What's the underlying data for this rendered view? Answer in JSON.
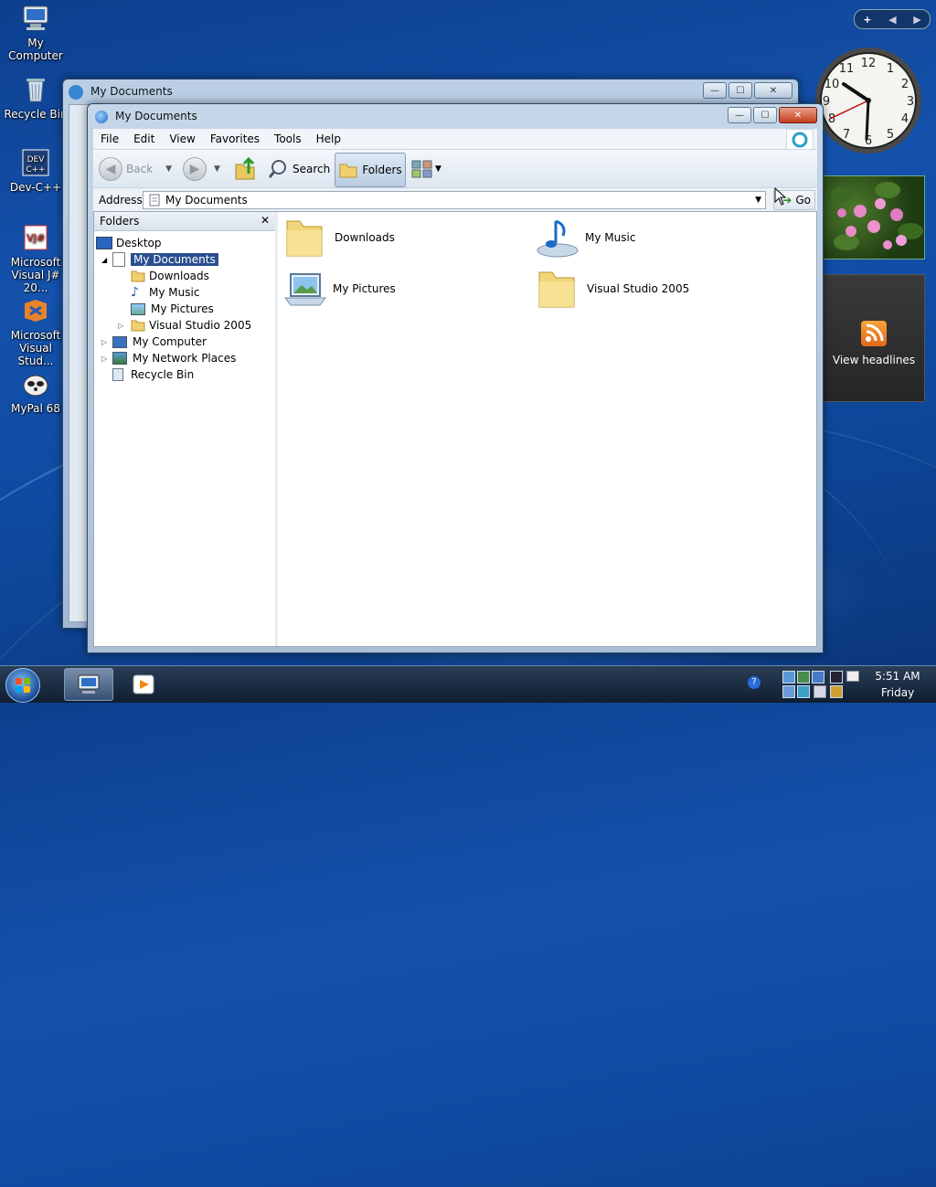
{
  "desktop": {
    "icons": [
      {
        "label": "My Computer"
      },
      {
        "label": "Recycle Bin"
      },
      {
        "label": "Dev-C++"
      },
      {
        "label": "Microsoft Visual J# 20..."
      },
      {
        "label": "Microsoft Visual Stud..."
      },
      {
        "label": "MyPal 68"
      }
    ]
  },
  "back_window": {
    "title": "My Documents"
  },
  "window": {
    "title": "My Documents",
    "menu": [
      "File",
      "Edit",
      "View",
      "Favorites",
      "Tools",
      "Help"
    ],
    "toolbar": {
      "back": "Back",
      "search": "Search",
      "folders": "Folders"
    },
    "address": {
      "label": "Address",
      "value": "My Documents",
      "go": "Go"
    },
    "folders_pane": {
      "title": "Folders",
      "tree": [
        {
          "label": "Desktop"
        },
        {
          "label": "My Documents"
        },
        {
          "label": "Downloads"
        },
        {
          "label": "My Music"
        },
        {
          "label": "My Pictures"
        },
        {
          "label": "Visual Studio 2005"
        },
        {
          "label": "My Computer"
        },
        {
          "label": "My Network Places"
        },
        {
          "label": "Recycle Bin"
        }
      ]
    },
    "items": [
      {
        "label": "Downloads"
      },
      {
        "label": "My Music"
      },
      {
        "label": "My Pictures"
      },
      {
        "label": "Visual Studio 2005"
      }
    ]
  },
  "gadgets": {
    "feed_label": "View headlines"
  },
  "taskbar": {
    "time": "5:51 AM",
    "day": "Friday"
  }
}
